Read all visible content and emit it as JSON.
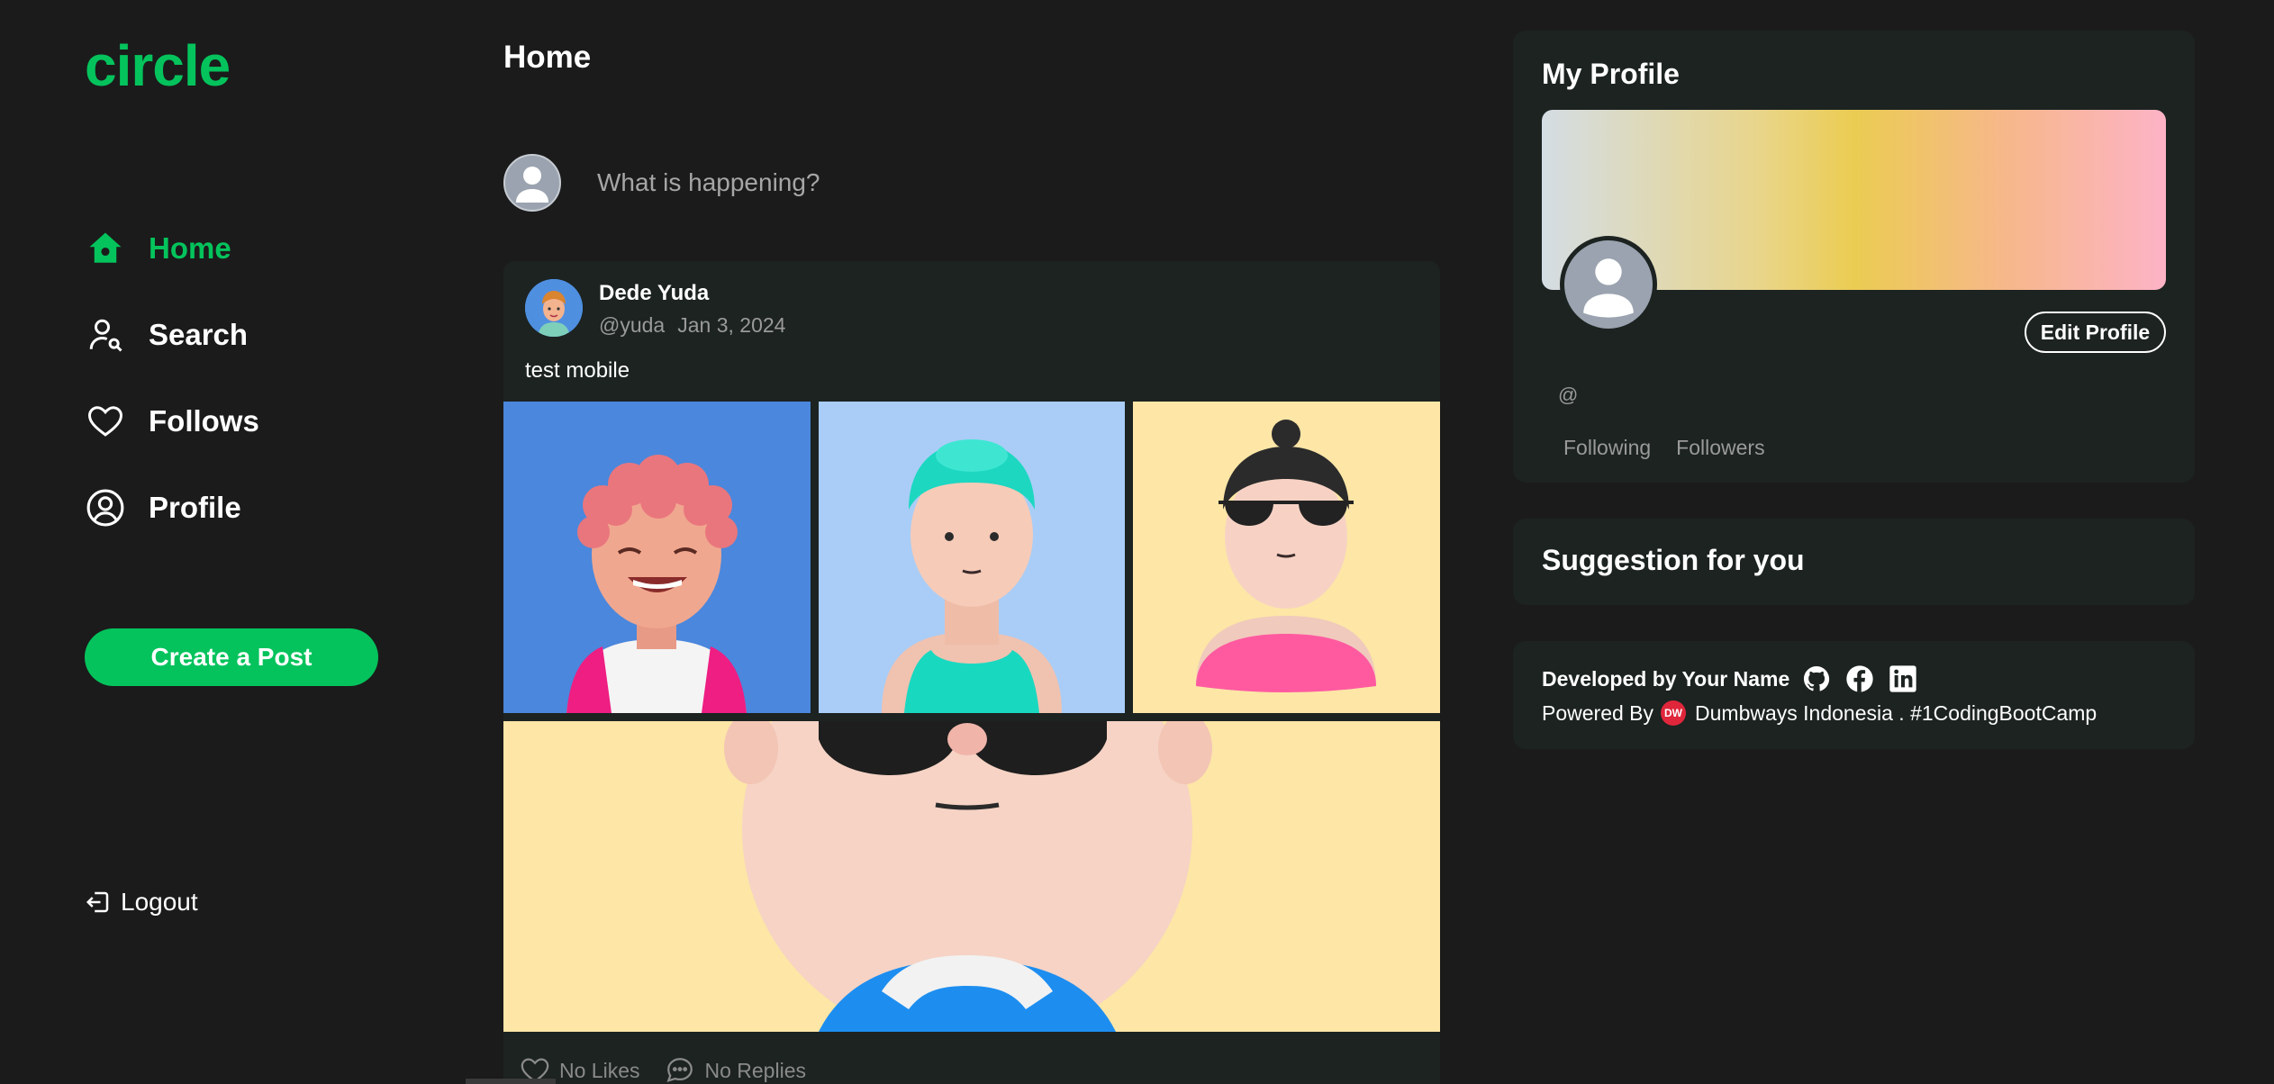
{
  "app": {
    "logo": "circle",
    "accent": "#04c35c",
    "background": "#1b1b1b",
    "card_background": "#1c2321"
  },
  "sidebar": {
    "items": [
      {
        "label": "Home",
        "icon": "home-icon",
        "active": true
      },
      {
        "label": "Search",
        "icon": "user-search-icon",
        "active": false
      },
      {
        "label": "Follows",
        "icon": "heart-icon",
        "active": false
      },
      {
        "label": "Profile",
        "icon": "user-circle-icon",
        "active": false
      }
    ],
    "create_label": "Create a Post",
    "logout_label": "Logout"
  },
  "main": {
    "title": "Home",
    "composer": {
      "placeholder": "What is happening?"
    },
    "post": {
      "author": "Dede Yuda",
      "handle": "@yuda",
      "date": "Jan 3, 2024",
      "text": "test mobile",
      "images": [
        "avatar-curly-hair",
        "avatar-teal-hair",
        "avatar-sunglasses-bun",
        "avatar-closeup-sunglasses"
      ],
      "likes_label": "No Likes",
      "replies_label": "No Replies"
    }
  },
  "profile": {
    "title": "My Profile",
    "edit_label": "Edit Profile",
    "handle": "@",
    "following_label": "Following",
    "followers_label": "Followers"
  },
  "suggestion": {
    "title": "Suggestion for you"
  },
  "footer": {
    "developed_by": "Developed by Your Name",
    "socials": [
      "github-icon",
      "facebook-icon",
      "linkedin-icon"
    ],
    "powered_by": "Powered By",
    "badge": "DW",
    "company": "Dumbways Indonesia . #1CodingBootCamp"
  }
}
